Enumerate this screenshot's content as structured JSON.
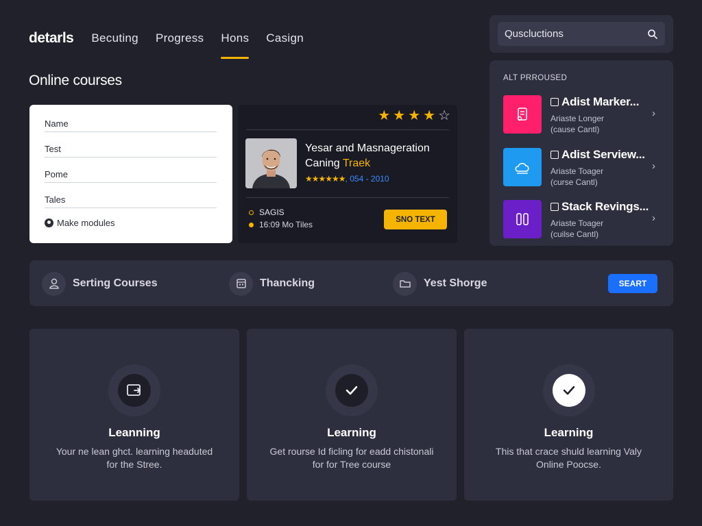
{
  "nav": {
    "brand": "detarls",
    "items": [
      {
        "label": "Becuting"
      },
      {
        "label": "Progress"
      },
      {
        "label": "Hons",
        "active": true
      },
      {
        "label": "Casign"
      }
    ]
  },
  "search": {
    "value": "Quscluctions",
    "icon": "search-icon"
  },
  "page": {
    "title": "Online courses"
  },
  "form": {
    "fields": [
      "Name",
      "Test",
      "Pome",
      "Tales"
    ],
    "action_label": "Make modules"
  },
  "course": {
    "rating_stars": 4,
    "rating_max": 5,
    "title_main": "Yesar and Masnageration Caning ",
    "title_highlight": "Traek",
    "mini_stars": "★★★★★★",
    "rating_meta": ", 054 - 2010",
    "meta1": "SAGIS",
    "meta2": "16:09 Mo Tiles",
    "button_label": "SNO TEXT"
  },
  "alt_panel": {
    "title": "ALT PRROUSED",
    "items": [
      {
        "name": "Adist Marker...",
        "sub1": "Ariaste Longer",
        "sub2": "(cause Cantl)",
        "color": "#ff1f6b",
        "icon": "document-icon"
      },
      {
        "name": "Adist Serview...",
        "sub1": "Ariaste Toager",
        "sub2": "(curse Cantl)",
        "color": "#1e9bf0",
        "icon": "cloud-icon"
      },
      {
        "name": "Stack Revings...",
        "sub1": "Ariaste Toager",
        "sub2": "(cuilse Cantl)",
        "color": "#6a1fc9",
        "icon": "columns-icon"
      }
    ]
  },
  "action_bar": {
    "items": [
      {
        "label": "Serting Courses",
        "icon": "user-icon"
      },
      {
        "label": "Thancking",
        "icon": "calendar-icon"
      },
      {
        "label": "Yest Shorge",
        "icon": "folder-icon"
      }
    ],
    "button_label": "SEART"
  },
  "features": [
    {
      "title": "Leanning",
      "desc": "Your ne lean ghct. learning headuted for the Stree.",
      "icon": "share-screen-icon"
    },
    {
      "title": "Learning",
      "desc": "Get rourse Id ficling for eadd chistonali for for Tree course",
      "icon": "check-icon"
    },
    {
      "title": "Learning",
      "desc": "This that crace shuld learning Valy Online Poocse.",
      "icon": "check-circle-icon"
    }
  ],
  "colors": {
    "background": "#20212b",
    "panel": "#2d2f3e",
    "accent_yellow": "#f5b400",
    "accent_blue": "#1a6fff"
  }
}
